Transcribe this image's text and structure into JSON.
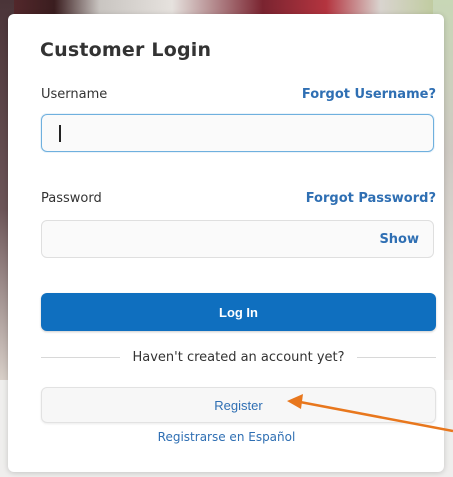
{
  "login": {
    "title": "Customer Login",
    "username_label": "Username",
    "forgot_username": "Forgot Username?",
    "username_value": "",
    "password_label": "Password",
    "forgot_password": "Forgot Password?",
    "password_value": "",
    "show_label": "Show",
    "login_button": "Log In",
    "divider_text": "Haven't created an account yet?",
    "register_button": "Register",
    "espanol_link": "Registrarse en Español"
  },
  "annotation": {
    "arrow_icon": "arrow-pointing-left-icon",
    "arrow_color": "#e8771d"
  },
  "colors": {
    "accent": "#0f6fbf",
    "link": "#2f6fb3",
    "focus_border": "#6fb0de"
  }
}
